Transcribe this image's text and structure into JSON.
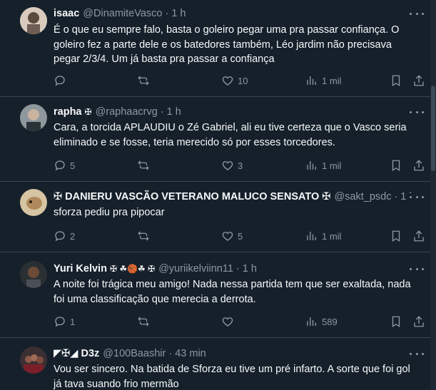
{
  "tweets": [
    {
      "name": "isaac",
      "badge": "",
      "handle": "@DinamiteVasco",
      "time": "· 1 h",
      "text": "É o que eu sempre falo, basta o goleiro pegar uma pra passar confiança. O goleiro fez a parte dele e os batedores também, Léo jardim não precisava pegar 2/3/4. Um já basta pra passar a confiança",
      "replies": "",
      "retweets": "",
      "likes": "10",
      "views": "1 mil",
      "avatar_color": "#c9b9a8"
    },
    {
      "name": "rapha",
      "badge": "✠",
      "handle": "@raphaacrvg",
      "time": "· 1 h",
      "text": "Cara, a torcida APLAUDIU o Zé Gabriel, ali eu tive certeza que o Vasco seria eliminado e se fosse, teria merecido só por esses torcedores.",
      "replies": "5",
      "retweets": "",
      "likes": "3",
      "views": "1 mil",
      "avatar_color": "#9aa3a8"
    },
    {
      "name": "✠ DANIERU VASCÃO VETERANO MALUCO SENSATO ✠",
      "badge": "",
      "handle": "@sakt_psdc",
      "time": "· 1 h",
      "text": "sforza pediu pra pipocar",
      "replies": "2",
      "retweets": "",
      "likes": "5",
      "views": "1 mil",
      "avatar_color": "#c7b08a"
    },
    {
      "name": "Yuri Kelvin",
      "badge": "✠ ☘🏀☘ ✠",
      "handle": "@yuriikelviinn11",
      "time": "· 1 h",
      "text": "A noite foi trágica meu amigo! Nada nessa partida tem que ser exaltada, nada foi uma classificação que merecia a derrota.",
      "replies": "1",
      "retweets": "",
      "likes": "",
      "views": "589",
      "avatar_color": "#3a3f44"
    },
    {
      "name": "◤✠◢ D3z",
      "badge": "",
      "handle": "@100Baashir",
      "time": "· 43 min",
      "text": "Vou ser sincero. Na batida de Sforza eu tive um pré infarto. A sorte que foi gol já tava suando frio mermão",
      "replies": "",
      "retweets": "",
      "likes": "",
      "views": "",
      "avatar_color": "#5a3b3b"
    }
  ],
  "icons": {
    "reply": "reply-icon",
    "retweet": "retweet-icon",
    "like": "heart-icon",
    "views": "views-icon",
    "bookmark": "bookmark-icon",
    "share": "share-icon",
    "more": "more-icon"
  },
  "colors": {
    "background": "#15202b",
    "text": "#f7f9f9",
    "muted": "#8b98a5",
    "divider": "#38444d"
  }
}
